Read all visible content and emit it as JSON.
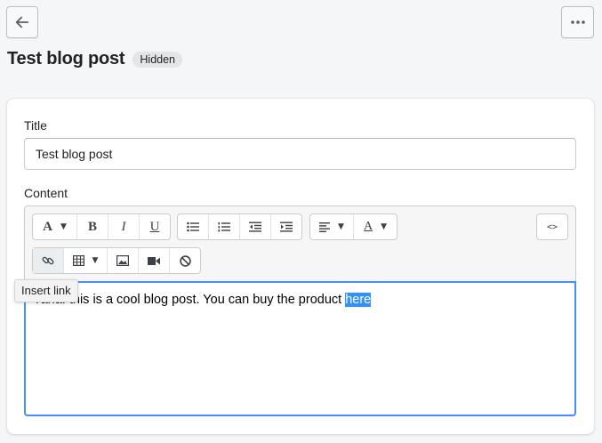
{
  "header": {
    "title": "Test blog post",
    "badge": "Hidden",
    "back_icon": "arrow-left-icon",
    "more_icon": "horizontal-dots-icon"
  },
  "form": {
    "title_label": "Title",
    "title_value": "Test blog post",
    "content_label": "Content"
  },
  "toolbar": {
    "row1": [
      "font-style-dropdown",
      "bold",
      "italic",
      "underline",
      "bulleted-list",
      "numbered-list",
      "outdent",
      "indent",
      "align-dropdown",
      "text-color-dropdown",
      "html-source"
    ],
    "row2": [
      "insert-link",
      "insert-table-dropdown",
      "insert-image",
      "insert-video",
      "clear-formatting"
    ],
    "font_glyph": "A",
    "bold_glyph": "B",
    "italic_glyph": "I",
    "underline_glyph": "U",
    "color_glyph": "A",
    "html_glyph": "<>"
  },
  "editor": {
    "text_before": "Yaha! this is a cool blog post. You can buy the product ",
    "text_selected": "here"
  },
  "tooltip": "Insert link",
  "colors": {
    "focus_border": "#458fff",
    "selection": "#3390ff",
    "background": "#f4f6f8"
  }
}
